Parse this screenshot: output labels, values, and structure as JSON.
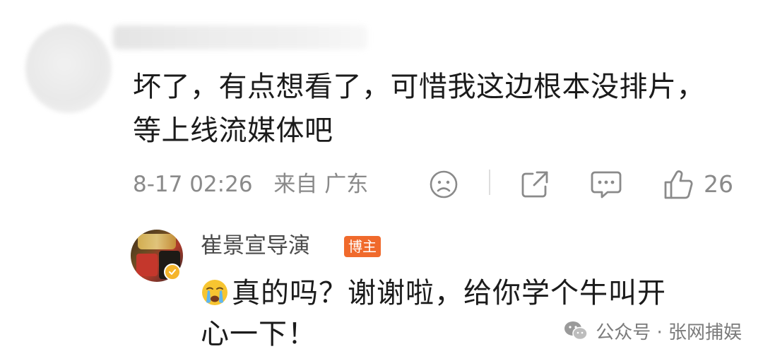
{
  "comment": {
    "text_line1": "坏了，有点想看了，可惜我这边根本没排片，",
    "text_line2": "等上线流媒体吧",
    "time": "8-17 02:26",
    "source": "来自 广东",
    "like_count": "26"
  },
  "reply": {
    "author": "崔景宣导演",
    "badge": "博主",
    "text_line1": "真的吗？谢谢啦，给你学个牛叫开",
    "text_line2": "心一下！"
  },
  "watermark": {
    "text": "公众号 · 张网捕娱"
  },
  "colors": {
    "meta_gray": "#8a8a8a",
    "badge_orange": "#f06a2c",
    "verify_yellow": "#f5b52c"
  }
}
